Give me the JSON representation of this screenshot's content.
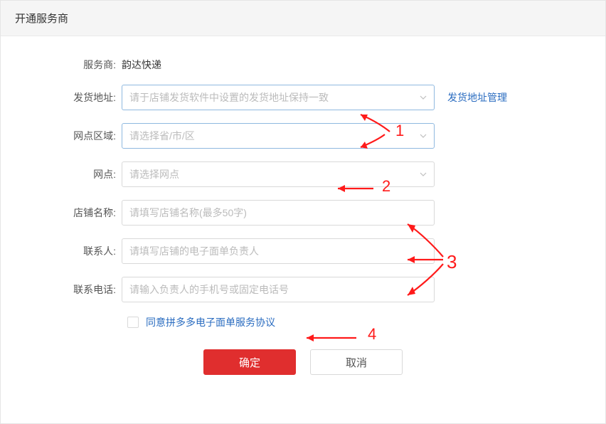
{
  "dialog": {
    "title": "开通服务商"
  },
  "form": {
    "provider_label": "服务商:",
    "provider_value": "韵达快递",
    "ship_addr_label": "发货地址:",
    "ship_addr_placeholder": "请于店铺发货软件中设置的发货地址保持一致",
    "ship_addr_manage_link": "发货地址管理",
    "region_label": "网点区域:",
    "region_placeholder": "请选择省/市/区",
    "branch_label": "网点:",
    "branch_placeholder": "请选择网点",
    "shop_name_label": "店铺名称:",
    "shop_name_placeholder": "请填写店铺名称(最多50字)",
    "contact_label": "联系人:",
    "contact_placeholder": "请填写店铺的电子面单负责人",
    "phone_label": "联系电话:",
    "phone_placeholder": "请输入负责人的手机号或固定电话号",
    "agreement_text": "同意拼多多电子面单服务协议"
  },
  "buttons": {
    "ok": "确定",
    "cancel": "取消"
  },
  "annotations": {
    "n1": "1",
    "n2": "2",
    "n3": "3",
    "n4": "4"
  }
}
